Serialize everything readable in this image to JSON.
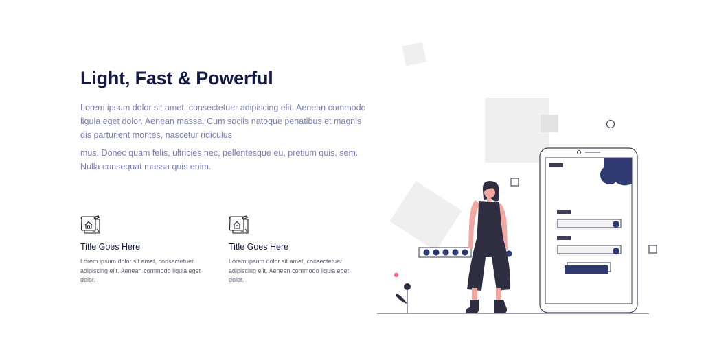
{
  "hero": {
    "title": "Light, Fast & Powerful",
    "paragraph_1": "Lorem ipsum dolor sit amet, consectetuer adipiscing elit. Aenean commodo ligula eget dolor. Aenean massa. Cum sociis natoque penatibus et magnis dis parturient montes, nascetur ridiculus",
    "paragraph_2": "mus. Donec quam felis, ultricies nec, pellentesque eu, pretium quis, sem. Nulla consequat massa quis enim."
  },
  "features": [
    {
      "icon": "blueprint-house-icon",
      "title": "Title Goes Here",
      "text": "Lorem ipsum dolor sit amet, consectetuer adipiscing elit. Aenean commodo ligula eget dolor."
    },
    {
      "icon": "blueprint-house-icon",
      "title": "Title Goes Here",
      "text": "Lorem ipsum dolor sit amet, consectetuer adipiscing elit. Aenean commodo ligula eget dolor."
    }
  ],
  "illustration": {
    "subject": "woman-with-phone-login-illustration",
    "colors": {
      "navy": "#2f3a73",
      "dark": "#2f2e41",
      "skin": "#f2a7a1",
      "gray": "#efefef",
      "accent": "#f16a82"
    }
  }
}
